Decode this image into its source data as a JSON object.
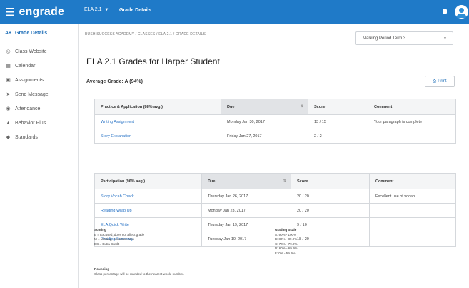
{
  "app": {
    "logo": "engrade",
    "course": "ELA 2.1",
    "page_title": "Grade Details"
  },
  "icons": {
    "menu": "hamburger-icon",
    "message": "message-icon",
    "avatar": "user-avatar-icon"
  },
  "colors": {
    "brand": "#1f7ac8",
    "link": "#2a74c6"
  },
  "sidebar": {
    "items": [
      {
        "icon": "A+",
        "label": "Grade Details",
        "active": true
      },
      {
        "icon": "◎",
        "label": "Class Website"
      },
      {
        "icon": "▦",
        "label": "Calendar"
      },
      {
        "icon": "▣",
        "label": "Assignments"
      },
      {
        "icon": "➤",
        "label": "Send Message"
      },
      {
        "icon": "◉",
        "label": "Attendance"
      },
      {
        "icon": "▲",
        "label": "Behavior Plus"
      },
      {
        "icon": "◆",
        "label": "Standards"
      }
    ]
  },
  "breadcrumb": "BUSH SUCCESS ACADEMY / CLASSES / ELA 2.1 / GRADE DETAILS",
  "period_select": "Marking Period Term 3",
  "title": "ELA 2.1 Grades for Harper Student",
  "average_grade": "Average Grade: A (94%)",
  "print_label": "Print",
  "table1": {
    "headers": [
      "Practice & Application (88% avg.)",
      "Due",
      "Score",
      "Comment"
    ],
    "rows": [
      [
        "Writing Assignment",
        "Monday Jan 30, 2017",
        "13 / 15",
        "Your paragraph is complete"
      ],
      [
        "Story Explanation",
        "Friday Jan 27, 2017",
        "2 / 2",
        ""
      ]
    ]
  },
  "table2": {
    "headers": [
      "Participation (96% avg.)",
      "Due",
      "Score",
      "Comment"
    ],
    "rows": [
      [
        "Story Vocab Check",
        "Thursday Jan 26, 2017",
        "20 / 20",
        "Excellent use of vocab"
      ],
      [
        "Reading Wrap Up",
        "Monday Jan 23, 2017",
        "20 / 20",
        ""
      ],
      [
        "ELA Quick Write",
        "Thursday Jan 19, 2017",
        "9 / 10",
        ""
      ],
      [
        "Reading Summary",
        "Tuesday Jan 10, 2017",
        "18 / 20",
        ""
      ]
    ]
  },
  "scoring": {
    "title": "Scoring",
    "lines": [
      "E = Excused, does not affect grade",
      "M = Missing, counts as zero",
      "EC = Extra Credit"
    ]
  },
  "grading_scale": {
    "title": "Grading Scale",
    "lines": [
      "A: 90% - 100%",
      "B: 80% - 89.9%",
      "C: 70% - 79.9%",
      "D: 60% - 69.9%",
      "F: 0% - 59.9%"
    ]
  },
  "rounding": {
    "title": "Rounding",
    "text": "Class percentage will be rounded to the nearest whole number."
  }
}
